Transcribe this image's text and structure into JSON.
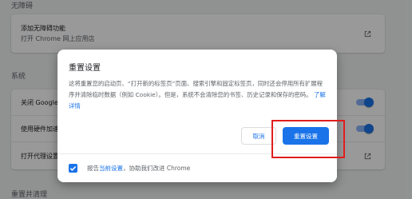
{
  "settings": {
    "accessibility_title": "无障碍",
    "accessibility_item_label": "添加无障碍功能",
    "accessibility_item_sub": "打开 Chrome 网上应用店",
    "system_title": "系统",
    "system_items": [
      {
        "label": "关闭 Google Chrome 后继续运行后台应用"
      },
      {
        "label": "使用硬件加速模式（如果可用）"
      },
      {
        "label": "打开代理设置"
      }
    ],
    "reset_section_title": "重置并清理"
  },
  "dialog": {
    "title": "重置设置",
    "body_text": "这将重置您的启动页、“打开新的标签页”页面、搜索引擎和固定标签页，同时还会停用所有扩展程序并清除临时数据（例如 Cookie）。但是，系统不会清除您的书签、历史记录和保存的密码。",
    "learn_more": "了解详情",
    "cancel_label": "取消",
    "reset_label": "重置设置",
    "footer_prefix": "报告",
    "footer_link": "当前设置",
    "footer_suffix": "，协助我们改进 Chrome"
  },
  "colors": {
    "accent": "#1a73e8",
    "highlight": "#e11d1d"
  },
  "icons": {
    "external_link": "external-link-icon",
    "checkbox": "checkbox-checked-icon"
  }
}
